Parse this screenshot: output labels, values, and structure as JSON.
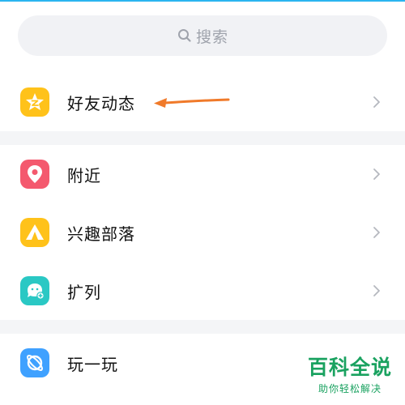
{
  "search": {
    "placeholder": "搜索"
  },
  "menu": {
    "section1": [
      {
        "label": "好友动态",
        "icon": "star-icon",
        "color": "#ffc21a"
      }
    ],
    "section2": [
      {
        "label": "附近",
        "icon": "location-pin-icon",
        "color": "#f4596e"
      },
      {
        "label": "兴趣部落",
        "icon": "tent-icon",
        "color": "#ffc21a"
      },
      {
        "label": "扩列",
        "icon": "chat-face-icon",
        "color": "#2ac8c4"
      }
    ],
    "section3": [
      {
        "label": "玩一玩",
        "icon": "planet-icon",
        "color": "#3fa1ff"
      }
    ]
  },
  "annotation": {
    "arrow_color": "#f07a2a"
  },
  "watermark": {
    "title": "百科全说",
    "subtitle": "助你轻松解决",
    "color": "#1aa260"
  }
}
